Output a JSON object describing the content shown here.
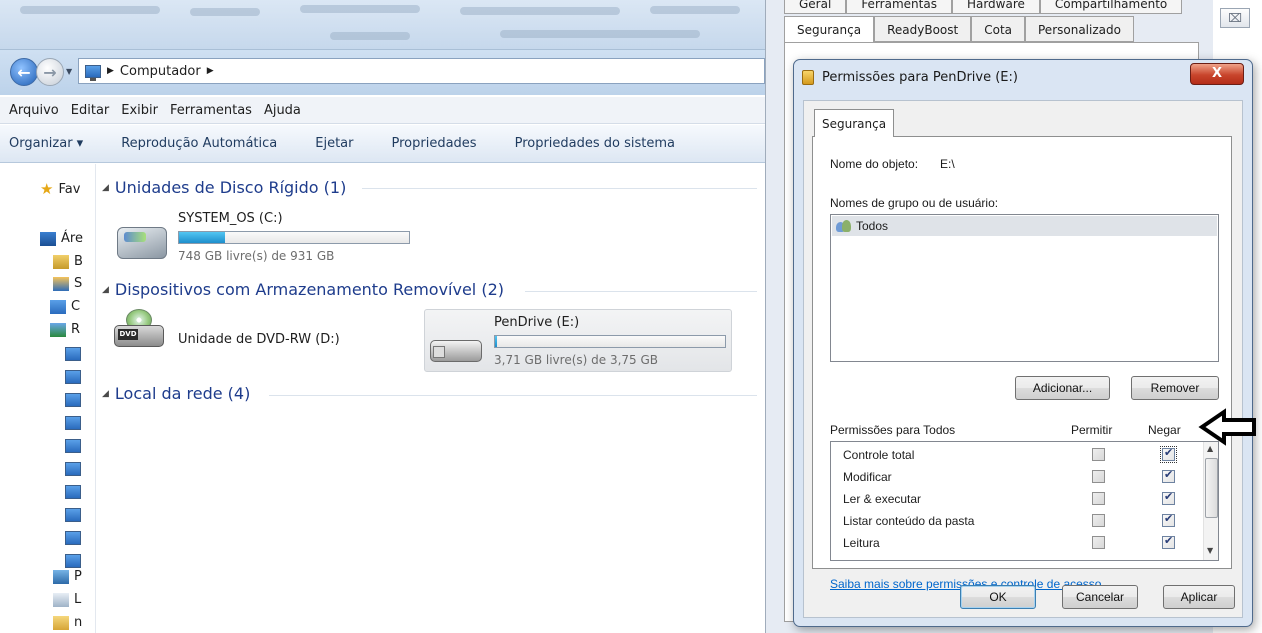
{
  "explorer": {
    "address": {
      "segments": [
        "Computador"
      ]
    },
    "menu": [
      "Arquivo",
      "Editar",
      "Exibir",
      "Ferramentas",
      "Ajuda"
    ],
    "toolbar": [
      "Organizar ▾",
      "Reprodução Automática",
      "Ejetar",
      "Propriedades",
      "Propriedades do sistema"
    ],
    "sidebar": [
      {
        "label": "Fav",
        "icon": "star-icon"
      },
      {
        "label": "Áre",
        "icon": "desktop-icon"
      },
      {
        "label": "B",
        "icon": "library-icon"
      },
      {
        "label": "S",
        "icon": "user-icon"
      },
      {
        "label": "C",
        "icon": "computer-icon"
      },
      {
        "label": "R",
        "icon": "network-icon"
      },
      {
        "label": "P",
        "icon": "control-panel-icon"
      },
      {
        "label": "L",
        "icon": "recycle-bin-icon"
      },
      {
        "label": "n",
        "icon": "folder-icon"
      }
    ],
    "groups": {
      "hdd": "Unidades de Disco Rígido (1)",
      "removable": "Dispositivos com Armazenamento Removível (2)",
      "network": "Local da rede (4)"
    },
    "drives": {
      "c": {
        "name": "SYSTEM_OS (C:)",
        "free": "748 GB livre(s) de 931 GB",
        "used_fraction": 0.2
      },
      "d": {
        "name": "Unidade de DVD-RW (D:)",
        "tag": "DVD"
      },
      "e": {
        "name": "PenDrive (E:)",
        "free": "3,71 GB livre(s) de 3,75 GB",
        "used_fraction": 0.01
      }
    }
  },
  "props": {
    "tabs_top": [
      "Geral",
      "Ferramentas",
      "Hardware",
      "Compartilhamento"
    ],
    "tabs": [
      "Segurança",
      "ReadyBoost",
      "Cota",
      "Personalizado"
    ],
    "close": "⌧"
  },
  "perm_dialog": {
    "title": "Permissões para PenDrive (E:)",
    "close": "X",
    "tab": "Segurança",
    "object_label": "Nome do objeto:",
    "object_value": "E:\\",
    "groups_label": "Nomes de grupo ou de usuário:",
    "users": [
      "Todos"
    ],
    "add_button": "Adicionar...",
    "remove_button": "Remover",
    "perms_label": "Permissões para Todos",
    "allow_header": "Permitir",
    "deny_header": "Negar",
    "permissions": [
      {
        "name": "Controle total",
        "allow": false,
        "deny": true
      },
      {
        "name": "Modificar",
        "allow": false,
        "deny": true
      },
      {
        "name": "Ler & executar",
        "allow": false,
        "deny": true
      },
      {
        "name": "Listar conteúdo da pasta",
        "allow": false,
        "deny": true
      },
      {
        "name": "Leitura",
        "allow": false,
        "deny": true
      }
    ],
    "link": "Saiba mais sobre permissões e controle de acesso",
    "ok": "OK",
    "cancel": "Cancelar",
    "apply": "Aplicar"
  }
}
